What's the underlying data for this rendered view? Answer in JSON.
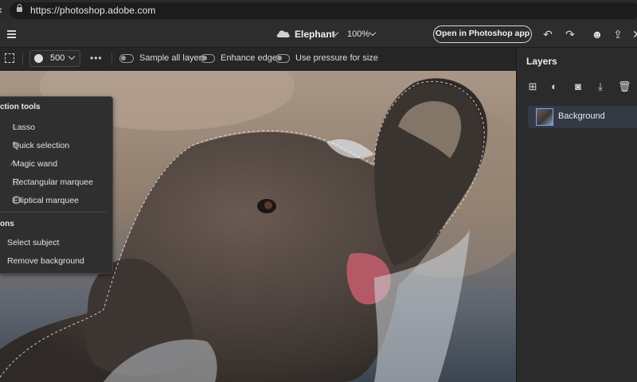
{
  "browser": {
    "url": "https://photoshop.adobe.com"
  },
  "header": {
    "doc_name": "Elephant",
    "zoom": "100%",
    "open_button": "Open in Photoshop app",
    "icons": [
      "menu-icon",
      "cloud-icon",
      "undo-icon",
      "redo-icon",
      "account-icon",
      "share-icon",
      "close-icon"
    ]
  },
  "options": {
    "brush_size": "500",
    "more": "•••",
    "toggles": [
      {
        "label": "Sample all layers",
        "on": false
      },
      {
        "label": "Enhance edges",
        "on": false
      },
      {
        "label": "Use pressure for size",
        "on": false
      }
    ]
  },
  "popup": {
    "tools_heading": "ction tools",
    "tools": [
      "Lasso",
      "Quick selection",
      "Magic wand",
      "Rectangular marquee",
      "Elliptical marquee"
    ],
    "actions_heading": "ons",
    "actions": [
      "Select subject",
      "Remove background"
    ]
  },
  "layers": {
    "title": "Layers",
    "items": [
      {
        "name": "Background",
        "selected": true
      }
    ]
  },
  "colors": {
    "accent": "#7aa2ff",
    "panel": "#2b2b2b",
    "bar": "#2d2d2d"
  }
}
